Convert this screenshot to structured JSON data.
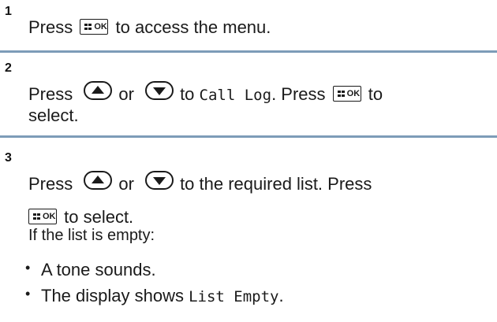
{
  "step1": {
    "number": "1",
    "text_before": "Press",
    "ok_label": "OK",
    "text_after": "to access the menu."
  },
  "step2": {
    "number": "2",
    "text_press": "Press",
    "text_or": "or",
    "text_to": "to",
    "menu_item": "Call Log",
    "text_press2": ". Press",
    "ok_label": "OK",
    "text_to2": "to",
    "text_select": "select."
  },
  "step3": {
    "number": "3",
    "text_press": "Press",
    "text_or": "or",
    "text_rest": "to the required list. Press",
    "ok_label": "OK",
    "text_select": "to select.",
    "text_empty": "If the list is empty:",
    "bullets": [
      "A tone sounds.",
      "The display shows"
    ],
    "display_text": "List Empty",
    "period": "."
  },
  "icons": {
    "ok_key": "menu-ok-key-icon",
    "up_key": "up-arrow-key-icon",
    "down_key": "down-arrow-key-icon"
  },
  "colors": {
    "separator": "#7d9cb8",
    "text": "#1a1a1a"
  }
}
